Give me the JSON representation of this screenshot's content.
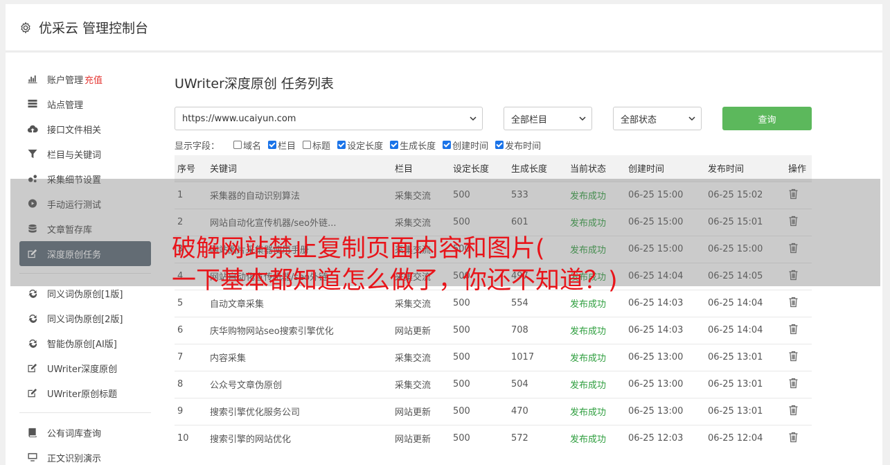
{
  "header": {
    "title": "优采云 管理控制台",
    "icon": "gear-icon"
  },
  "sidebar": {
    "groups": [
      [
        {
          "label": "账户管理",
          "extra": "充值",
          "icon": "bar-chart-icon"
        },
        {
          "label": "站点管理",
          "icon": "server-icon"
        },
        {
          "label": "接口文件相关",
          "icon": "cloud-upload-icon"
        },
        {
          "label": "栏目与关键词",
          "icon": "filter-icon"
        },
        {
          "label": "采集细节设置",
          "icon": "gears-icon"
        },
        {
          "label": "手动运行测试",
          "icon": "play-icon"
        },
        {
          "label": "文章暂存库",
          "icon": "database-icon"
        },
        {
          "label": "深度原创任务",
          "icon": "edit-icon",
          "active": true
        }
      ],
      [
        {
          "label": "同义词伪原创[1版]",
          "icon": "refresh-icon"
        },
        {
          "label": "同义词伪原创[2版]",
          "icon": "refresh-icon"
        },
        {
          "label": "智能伪原创[AI版]",
          "icon": "refresh-icon"
        },
        {
          "label": "UWriter深度原创",
          "icon": "edit-icon"
        },
        {
          "label": "UWriter原创标题",
          "icon": "edit-icon"
        }
      ],
      [
        {
          "label": "公有词库查询",
          "icon": "book-icon"
        },
        {
          "label": "正文识别演示",
          "icon": "monitor-icon"
        }
      ]
    ]
  },
  "main": {
    "title": "UWriter深度原创 任务列表",
    "site_select": "https://www.ucaiyun.com",
    "column_select": "全部栏目",
    "status_select": "全部状态",
    "query_label": "查询",
    "fields_label": "显示字段：",
    "fields": [
      {
        "label": "域名",
        "checked": false
      },
      {
        "label": "栏目",
        "checked": true
      },
      {
        "label": "标题",
        "checked": false
      },
      {
        "label": "设定长度",
        "checked": true
      },
      {
        "label": "生成长度",
        "checked": true
      },
      {
        "label": "创建时间",
        "checked": true
      },
      {
        "label": "发布时间",
        "checked": true
      }
    ],
    "columns": [
      "序号",
      "关键词",
      "栏目",
      "设定长度",
      "生成长度",
      "当前状态",
      "创建时间",
      "发布时间",
      "操作"
    ],
    "rows": [
      [
        "1",
        "采集器的自动识别算法",
        "采集交流",
        "500",
        "533",
        "发布成功",
        "06-25 15:00",
        "06-25 15:02"
      ],
      [
        "2",
        "网站自动化宣传机器/seo外链...",
        "采集交流",
        "500",
        "601",
        "发布成功",
        "06-25 15:00",
        "06-25 15:01"
      ],
      [
        "3",
        "网站图片采集器使用手册",
        "采集交流",
        "500",
        "",
        "发布成功",
        "06-25 15:00",
        "06-25 15:00"
      ],
      [
        "4",
        "网站自动化宣传机器/seo外链",
        "采集交流",
        "500",
        "497",
        "发布成功",
        "06-25 14:04",
        "06-25 14:05"
      ],
      [
        "5",
        "自动文章采集",
        "采集交流",
        "500",
        "554",
        "发布成功",
        "06-25 14:03",
        "06-25 14:04"
      ],
      [
        "6",
        "庆华购物网站seo搜索引擎优化",
        "网站更新",
        "500",
        "708",
        "发布成功",
        "06-25 14:03",
        "06-25 14:04"
      ],
      [
        "7",
        "内容采集",
        "采集交流",
        "500",
        "1017",
        "发布成功",
        "06-25 13:00",
        "06-25 13:01"
      ],
      [
        "8",
        "公众号文章伪原创",
        "采集交流",
        "500",
        "504",
        "发布成功",
        "06-25 13:00",
        "06-25 13:01"
      ],
      [
        "9",
        "搜索引擎优化服务公司",
        "网站更新",
        "500",
        "470",
        "发布成功",
        "06-25 13:00",
        "06-25 13:01"
      ],
      [
        "10",
        "搜索引擎的网站优化",
        "网站更新",
        "500",
        "572",
        "发布成功",
        "06-25 12:03",
        "06-25 12:04"
      ]
    ]
  },
  "banner": {
    "line1": "破解网站禁止复制页面内容和图片(",
    "line2": "一下基本都知道怎么做了，你还不知道？)"
  },
  "colors": {
    "accent_green": "#5cb85c",
    "status_green": "#2e9e3e",
    "active_bg": "#5d6b77",
    "banner_red": "#e8141a"
  }
}
